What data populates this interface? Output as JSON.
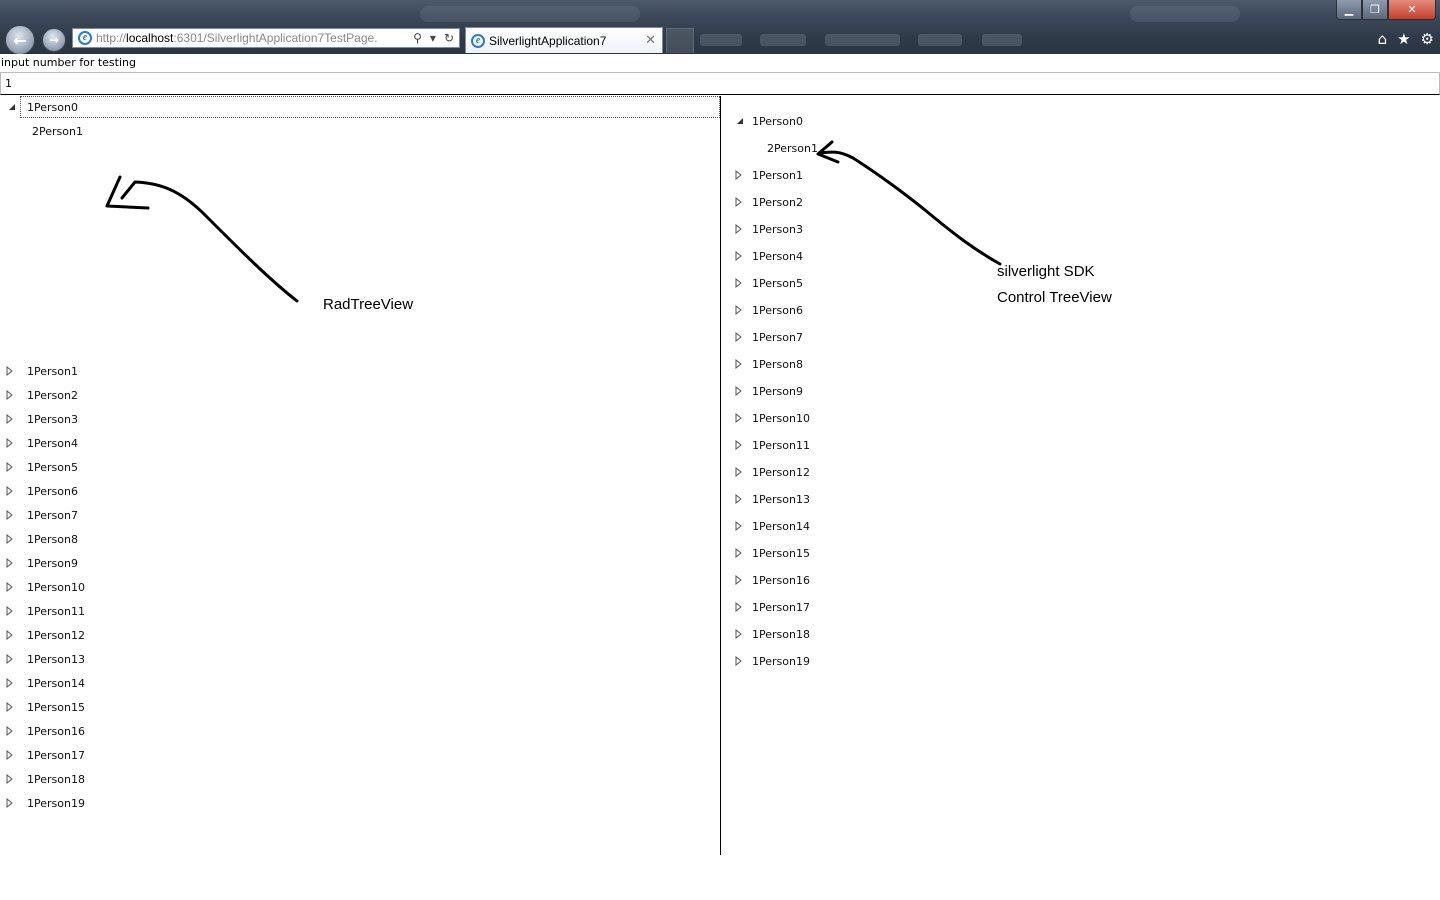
{
  "browser": {
    "address_url_prefix": "http://",
    "address_url_host": "localhost",
    "address_url_rest": ":6301/SilverlightApplication7TestPage.",
    "tab_title": "SilverlightApplication7",
    "tab_close": "✕",
    "icons": {
      "back": "back-arrow-icon",
      "forward": "forward-arrow-icon",
      "search": "search-icon",
      "dropdown": "chevron-down-icon",
      "refresh": "refresh-icon",
      "home": "home-icon",
      "favorites": "star-icon",
      "tools": "gear-icon",
      "minimize": "minimize-icon",
      "maximize": "restore-icon",
      "close": "close-icon"
    }
  },
  "page": {
    "input_label": "input number for testing",
    "input_value": "1"
  },
  "rad_tree": {
    "expanded": {
      "label": "1Person0",
      "child": "2Person1"
    },
    "items": [
      "1Person1",
      "1Person2",
      "1Person3",
      "1Person4",
      "1Person5",
      "1Person6",
      "1Person7",
      "1Person8",
      "1Person9",
      "1Person10",
      "1Person11",
      "1Person12",
      "1Person13",
      "1Person14",
      "1Person15",
      "1Person16",
      "1Person17",
      "1Person18",
      "1Person19"
    ]
  },
  "sdk_tree": {
    "expanded": {
      "label": "1Person0",
      "child": "2Person1"
    },
    "items": [
      "1Person1",
      "1Person2",
      "1Person3",
      "1Person4",
      "1Person5",
      "1Person6",
      "1Person7",
      "1Person8",
      "1Person9",
      "1Person10",
      "1Person11",
      "1Person12",
      "1Person13",
      "1Person14",
      "1Person15",
      "1Person16",
      "1Person17",
      "1Person18",
      "1Person19"
    ]
  },
  "annotations": {
    "left": "RadTreeView",
    "right_line1": "silverlight SDK",
    "right_line2": "Control TreeView"
  }
}
